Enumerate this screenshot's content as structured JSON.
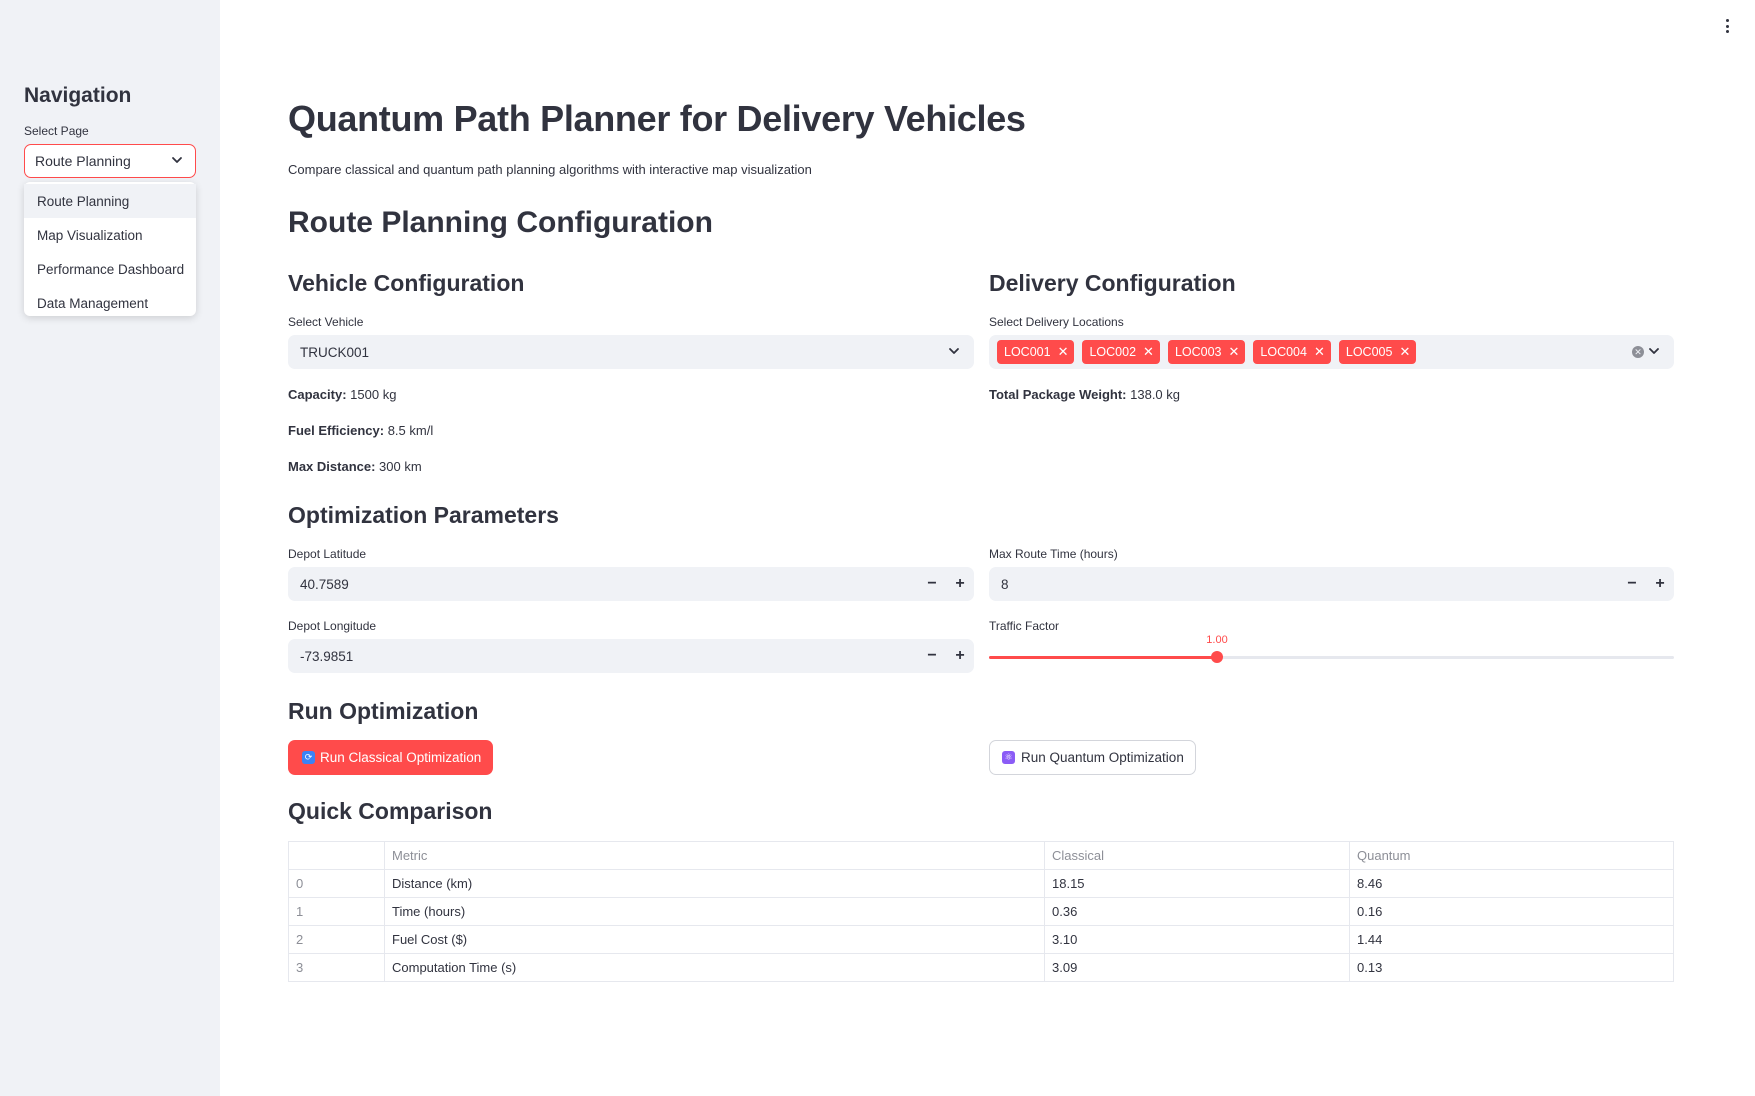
{
  "sidebar": {
    "title": "Navigation",
    "select_label": "Select Page",
    "selected": "Route Planning",
    "options": [
      "Route Planning",
      "Map Visualization",
      "Performance Dashboard",
      "Data Management"
    ]
  },
  "header": {
    "title": "Quantum Path Planner for Delivery Vehicles",
    "subtitle": "Compare classical and quantum path planning algorithms with interactive map visualization"
  },
  "route_planning": {
    "title": "Route Planning Configuration"
  },
  "vehicle": {
    "title": "Vehicle Configuration",
    "select_label": "Select Vehicle",
    "selected": "TRUCK001",
    "capacity_label": "Capacity:",
    "capacity_value": "1500 kg",
    "fuel_label": "Fuel Efficiency:",
    "fuel_value": "8.5 km/l",
    "distance_label": "Max Distance:",
    "distance_value": "300 km"
  },
  "delivery": {
    "title": "Delivery Configuration",
    "select_label": "Select Delivery Locations",
    "tags": [
      "LOC001",
      "LOC002",
      "LOC003",
      "LOC004",
      "LOC005"
    ],
    "weight_label": "Total Package Weight:",
    "weight_value": "138.0 kg"
  },
  "optimization": {
    "title": "Optimization Parameters",
    "depot_lat_label": "Depot Latitude",
    "depot_lat": "40.7589",
    "max_time_label": "Max Route Time (hours)",
    "max_time": "8",
    "depot_lon_label": "Depot Longitude",
    "depot_lon": "-73.9851",
    "traffic_label": "Traffic Factor",
    "traffic_value": "1.00",
    "traffic_fraction": 0.333
  },
  "run": {
    "title": "Run Optimization",
    "classical_label": "Run Classical Optimization",
    "quantum_label": "Run Quantum Optimization"
  },
  "comparison": {
    "title": "Quick Comparison",
    "headers": [
      "",
      "Metric",
      "Classical",
      "Quantum"
    ],
    "rows": [
      [
        "0",
        "Distance (km)",
        "18.15",
        "8.46"
      ],
      [
        "1",
        "Time (hours)",
        "0.36",
        "0.16"
      ],
      [
        "2",
        "Fuel Cost ($)",
        "3.10",
        "1.44"
      ],
      [
        "3",
        "Computation Time (s)",
        "3.09",
        "0.13"
      ]
    ]
  },
  "colors": {
    "accent": "#ff4b4b",
    "sidebar_bg": "#f0f2f6",
    "text": "#31333f"
  },
  "icons": {
    "classical_button": "refresh-icon",
    "quantum_button": "atom-icon"
  }
}
